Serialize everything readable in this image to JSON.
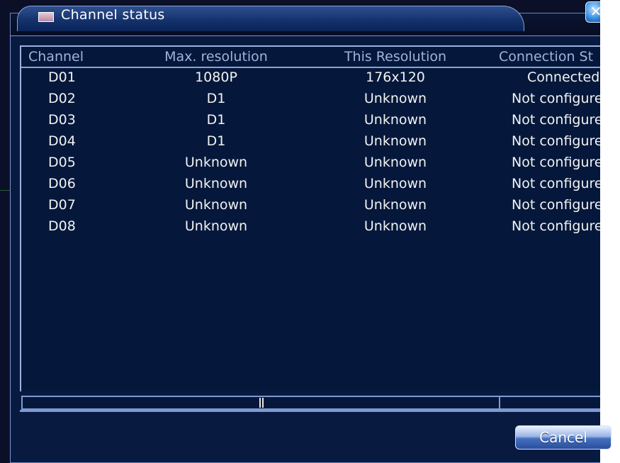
{
  "dialog": {
    "title": "Channel status",
    "close_symbol": "✕",
    "cancel_label": "Cancel"
  },
  "table": {
    "columns": {
      "channel": "Channel",
      "max_resolution": "Max. resolution",
      "this_resolution": "This Resolution",
      "connection_status": "Connection St"
    },
    "rows": [
      {
        "channel": "D01",
        "max_resolution": "1080P",
        "this_resolution": "176x120",
        "connection_status": "Connected"
      },
      {
        "channel": "D02",
        "max_resolution": "D1",
        "this_resolution": "Unknown",
        "connection_status": "Not configure"
      },
      {
        "channel": "D03",
        "max_resolution": "D1",
        "this_resolution": "Unknown",
        "connection_status": "Not configure"
      },
      {
        "channel": "D04",
        "max_resolution": "D1",
        "this_resolution": "Unknown",
        "connection_status": "Not configure"
      },
      {
        "channel": "D05",
        "max_resolution": "Unknown",
        "this_resolution": "Unknown",
        "connection_status": "Not configure"
      },
      {
        "channel": "D06",
        "max_resolution": "Unknown",
        "this_resolution": "Unknown",
        "connection_status": "Not configure"
      },
      {
        "channel": "D07",
        "max_resolution": "Unknown",
        "this_resolution": "Unknown",
        "connection_status": "Not configure"
      },
      {
        "channel": "D08",
        "max_resolution": "Unknown",
        "this_resolution": "Unknown",
        "connection_status": "Not configure"
      }
    ]
  },
  "icons": {
    "title_icon": "window-icon",
    "close_icon": "close-icon",
    "scroll_grip": "scrollbar-grip-icon",
    "scroll_arrow": "chevron-right-icon"
  },
  "colors": {
    "background": "#081a40",
    "header_text": "#9fb3dc",
    "cell_text": "#f2f2f2",
    "accent": "#7f9ad2"
  }
}
